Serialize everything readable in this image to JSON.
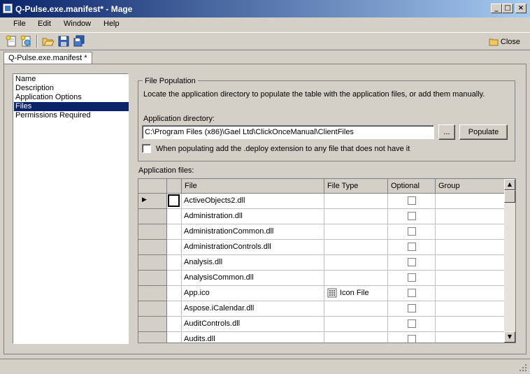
{
  "window": {
    "title": "Q-Pulse.exe.manifest* - Mage"
  },
  "menu": [
    {
      "label": "File"
    },
    {
      "label": "Edit"
    },
    {
      "label": "Window"
    },
    {
      "label": "Help"
    }
  ],
  "toolbar": {
    "close_label": "Close"
  },
  "tab": {
    "label": "Q-Pulse.exe.manifest *"
  },
  "nav": {
    "items": [
      "Name",
      "Description",
      "Application Options",
      "Files",
      "Permissions Required"
    ],
    "selected": "Files"
  },
  "file_population": {
    "title": "File Population",
    "description": "Locate the application directory to populate the table with the application files, or add them manually.",
    "dir_label": "Application directory:",
    "dir_value": "C:\\Program Files (x86)\\Gael Ltd\\ClickOnceManual\\ClientFiles",
    "browse_label": "...",
    "populate_label": "Populate",
    "deploy_checkbox_label": "When populating add the .deploy extension to any file that does not have it"
  },
  "grid": {
    "label": "Application files:",
    "columns": [
      "File",
      "File Type",
      "Optional",
      "Group"
    ],
    "rows": [
      {
        "file": "ActiveObjects2.dll",
        "type": ""
      },
      {
        "file": "Administration.dll",
        "type": ""
      },
      {
        "file": "AdministrationCommon.dll",
        "type": ""
      },
      {
        "file": "AdministrationControls.dll",
        "type": ""
      },
      {
        "file": "Analysis.dll",
        "type": ""
      },
      {
        "file": "AnalysisCommon.dll",
        "type": ""
      },
      {
        "file": "App.ico",
        "type": "Icon File"
      },
      {
        "file": "Aspose.iCalendar.dll",
        "type": ""
      },
      {
        "file": "AuditControls.dll",
        "type": ""
      },
      {
        "file": "Audits.dll",
        "type": ""
      }
    ]
  }
}
